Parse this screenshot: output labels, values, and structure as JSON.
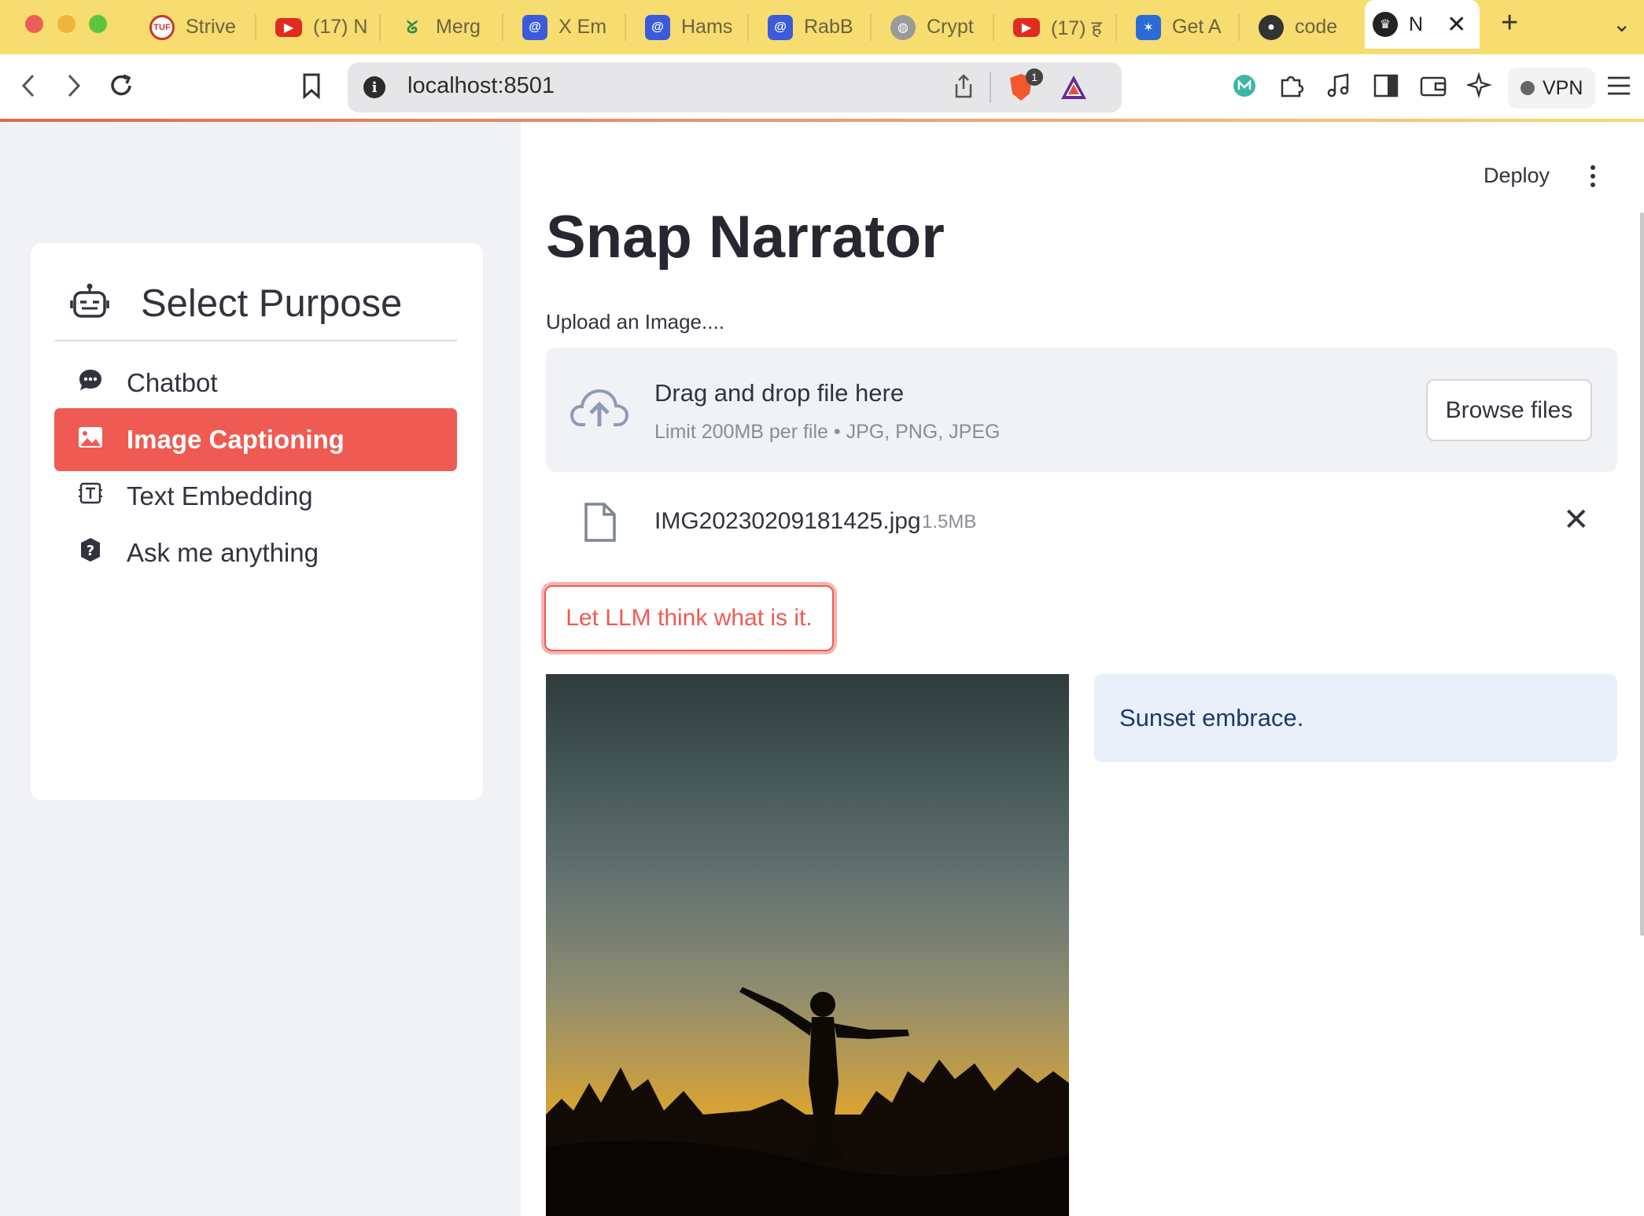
{
  "browser": {
    "tabs": [
      {
        "title": "Strive",
        "icon": "tuf-icon",
        "color": "#c7372b"
      },
      {
        "title": "(17) N",
        "icon": "youtube-icon",
        "color": "#e02b20"
      },
      {
        "title": "Merg",
        "icon": "gfg-icon",
        "color": "#2f8d46"
      },
      {
        "title": "X Em",
        "icon": "app-icon",
        "color": "#3b5bdb"
      },
      {
        "title": "Hams",
        "icon": "app-icon",
        "color": "#3b5bdb"
      },
      {
        "title": "RabB",
        "icon": "app-icon",
        "color": "#3b5bdb"
      },
      {
        "title": "Crypt",
        "icon": "globe-icon",
        "color": "#8a8a8a"
      },
      {
        "title": "(17) ह",
        "icon": "youtube-icon",
        "color": "#e02b20"
      },
      {
        "title": "Get A",
        "icon": "butterfly-icon",
        "color": "#2a6bd8"
      },
      {
        "title": "code",
        "icon": "github-icon",
        "color": "#333333"
      }
    ],
    "active_tab": {
      "title": "N",
      "icon": "crown-icon"
    },
    "new_tab_label": "+",
    "tab_menu_icon": "chevron-down-icon",
    "url": "localhost:8501",
    "brave_badge": "1",
    "vpn_label": "VPN"
  },
  "sidebar": {
    "title": "Select Purpose",
    "items": [
      {
        "label": "Chatbot",
        "icon": "chat-bubble-icon",
        "active": false
      },
      {
        "label": "Image Captioning",
        "icon": "image-icon",
        "active": true
      },
      {
        "label": "Text Embedding",
        "icon": "text-box-icon",
        "active": false
      },
      {
        "label": "Ask me anything",
        "icon": "question-circle-icon",
        "active": false
      }
    ]
  },
  "header": {
    "deploy_label": "Deploy"
  },
  "main": {
    "title": "Snap Narrator",
    "upload_label": "Upload an Image....",
    "dropzone": {
      "main_text": "Drag and drop file here",
      "sub_text": "Limit 200MB per file • JPG, PNG, JPEG",
      "browse_label": "Browse files"
    },
    "file": {
      "name": "IMG20230209181425.jpg",
      "size": "1.5MB"
    },
    "action_button": "Let LLM think what is it.",
    "caption": "Sunset embrace."
  },
  "colors": {
    "accent": "#ef5a52",
    "sidebar_bg": "#f0f2f6",
    "caption_bg": "#e9f0f9",
    "tabbar_bg": "#f7dc6f"
  }
}
